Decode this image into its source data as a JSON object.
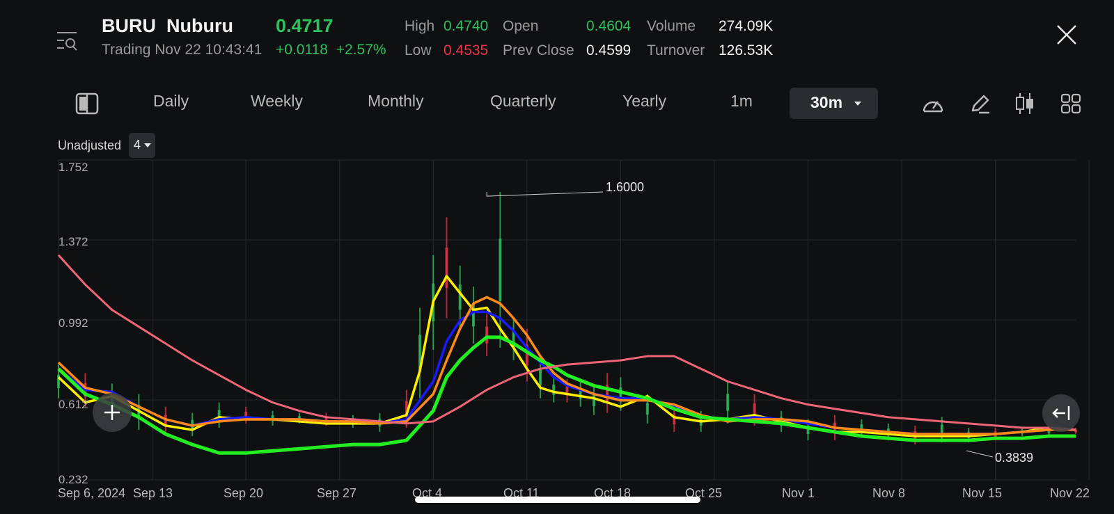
{
  "header": {
    "ticker": "BURU",
    "name": "Nuburu",
    "status": "Trading Nov 22 10:43:41",
    "price": "0.4717",
    "change": "+0.0118",
    "change_pct": "+2.57%",
    "high_label": "High",
    "high_value": "0.4740",
    "low_label": "Low",
    "low_value": "0.4535",
    "open_label": "Open",
    "open_value": "0.4604",
    "prev_close_label": "Prev Close",
    "prev_close_value": "0.4599",
    "volume_label": "Volume",
    "volume_value": "274.09K",
    "turnover_label": "Turnover",
    "turnover_value": "126.53K"
  },
  "tabs": [
    "Daily",
    "Weekly",
    "Monthly",
    "Quarterly",
    "Yearly",
    "1m"
  ],
  "active_tab": "30m",
  "adjust": {
    "label": "Unadjusted",
    "value": "4"
  },
  "icons": [
    "menu-search-icon",
    "close-icon",
    "sidebar-toggle-icon",
    "indicator-gauge-icon",
    "draw-pen-icon",
    "candlestick-icon",
    "grid-icon",
    "collapse-arrow-icon",
    "crosshair-plus-icon"
  ],
  "colors": {
    "up": "#2fbf5f",
    "down": "#e8334a",
    "ma_yellow": "#ffee00",
    "ma_blue": "#1a1aff",
    "ma_orange": "#ff8a1a",
    "ma_green": "#22ee22",
    "ma_pink": "#ee6677"
  },
  "chart_data": {
    "type": "line",
    "title": "",
    "ylim": [
      0.232,
      1.752
    ],
    "yticks": [
      "1.752",
      "1.372",
      "0.992",
      "0.612",
      "0.232"
    ],
    "xticks": [
      "Sep 6, 2024",
      "Sep 13",
      "Sep 20",
      "Sep 27",
      "Oct 4",
      "Oct 11",
      "Oct 18",
      "Oct 25",
      "Nov 1",
      "Nov 8",
      "Nov 15",
      "Nov 22"
    ],
    "annotations": [
      {
        "text": "1.6000",
        "x": "Oct 16",
        "y": 1.6
      },
      {
        "text": "0.3839",
        "x": "Nov 14",
        "y": 0.3839
      }
    ],
    "price_high_low": {
      "x": [
        0,
        2,
        4,
        6,
        8,
        10,
        12,
        14,
        16,
        18,
        20,
        22,
        24,
        26,
        27,
        28,
        29,
        30,
        31,
        32,
        33,
        34,
        35,
        36,
        37,
        38,
        39,
        40,
        41,
        42,
        44,
        46,
        48,
        50,
        52,
        54,
        56,
        58,
        60,
        62,
        64,
        66,
        68,
        70,
        72,
        74,
        76
      ],
      "high": [
        0.78,
        0.74,
        0.69,
        0.64,
        0.58,
        0.55,
        0.6,
        0.58,
        0.56,
        0.55,
        0.55,
        0.54,
        0.55,
        0.66,
        1.05,
        1.3,
        1.48,
        1.25,
        1.15,
        1.02,
        1.6,
        1.0,
        0.95,
        0.82,
        0.72,
        0.71,
        0.7,
        0.68,
        0.74,
        0.72,
        0.64,
        0.58,
        0.56,
        0.7,
        0.64,
        0.56,
        0.52,
        0.54,
        0.52,
        0.5,
        0.49,
        0.53,
        0.48,
        0.48,
        0.48,
        0.49,
        0.48
      ],
      "low": [
        0.62,
        0.58,
        0.52,
        0.47,
        0.45,
        0.44,
        0.48,
        0.5,
        0.49,
        0.5,
        0.49,
        0.48,
        0.46,
        0.48,
        0.62,
        0.85,
        1.0,
        0.95,
        0.88,
        0.82,
        0.86,
        0.8,
        0.7,
        0.62,
        0.6,
        0.6,
        0.58,
        0.54,
        0.55,
        0.56,
        0.5,
        0.46,
        0.46,
        0.5,
        0.49,
        0.46,
        0.42,
        0.42,
        0.44,
        0.42,
        0.4,
        0.41,
        0.41,
        0.42,
        0.44,
        0.44,
        0.45
      ]
    },
    "series": [
      {
        "color": "#ffee00",
        "x": [
          0,
          2,
          4,
          6,
          8,
          10,
          12,
          14,
          16,
          18,
          20,
          22,
          24,
          26,
          27,
          28,
          29,
          30,
          31,
          32,
          33,
          34,
          35,
          36,
          37,
          38,
          40,
          42,
          44,
          46,
          48,
          50,
          52,
          54,
          56,
          58,
          60,
          62,
          64,
          66,
          68,
          70,
          72,
          74,
          76
        ],
        "values": [
          0.72,
          0.6,
          0.63,
          0.56,
          0.49,
          0.47,
          0.53,
          0.52,
          0.52,
          0.51,
          0.5,
          0.5,
          0.5,
          0.54,
          0.75,
          1.08,
          1.2,
          1.12,
          1.04,
          1.05,
          0.95,
          0.86,
          0.76,
          0.67,
          0.65,
          0.64,
          0.62,
          0.58,
          0.63,
          0.53,
          0.51,
          0.52,
          0.54,
          0.51,
          0.48,
          0.46,
          0.46,
          0.45,
          0.44,
          0.44,
          0.44,
          0.45,
          0.46,
          0.48,
          0.47
        ]
      },
      {
        "color": "#1a1aff",
        "x": [
          0,
          2,
          4,
          6,
          8,
          10,
          12,
          14,
          16,
          18,
          20,
          22,
          24,
          26,
          28,
          29,
          30,
          31,
          32,
          33,
          34,
          35,
          36,
          37,
          38,
          40,
          42,
          44,
          46,
          48,
          50,
          52,
          54,
          56,
          58,
          60,
          62,
          64,
          66,
          68,
          70,
          72,
          74,
          76
        ],
        "values": [
          0.76,
          0.66,
          0.65,
          0.58,
          0.52,
          0.49,
          0.52,
          0.53,
          0.52,
          0.52,
          0.51,
          0.51,
          0.5,
          0.52,
          0.7,
          0.89,
          0.99,
          1.03,
          1.03,
          1.0,
          0.94,
          0.86,
          0.79,
          0.72,
          0.68,
          0.64,
          0.62,
          0.62,
          0.58,
          0.53,
          0.52,
          0.53,
          0.52,
          0.5,
          0.48,
          0.47,
          0.46,
          0.45,
          0.45,
          0.45,
          0.45,
          0.46,
          0.47,
          0.47
        ]
      },
      {
        "color": "#ff8a1a",
        "x": [
          0,
          2,
          4,
          6,
          8,
          10,
          12,
          14,
          16,
          18,
          20,
          22,
          24,
          26,
          28,
          29,
          30,
          31,
          32,
          33,
          34,
          35,
          36,
          37,
          38,
          40,
          42,
          44,
          46,
          48,
          50,
          52,
          54,
          56,
          58,
          60,
          62,
          64,
          66,
          68,
          70,
          72,
          74,
          76
        ],
        "values": [
          0.79,
          0.67,
          0.64,
          0.58,
          0.52,
          0.49,
          0.51,
          0.52,
          0.52,
          0.52,
          0.51,
          0.51,
          0.5,
          0.51,
          0.64,
          0.8,
          0.95,
          1.07,
          1.1,
          1.07,
          1.0,
          0.92,
          0.82,
          0.74,
          0.69,
          0.64,
          0.61,
          0.61,
          0.59,
          0.54,
          0.51,
          0.52,
          0.52,
          0.51,
          0.48,
          0.47,
          0.46,
          0.45,
          0.45,
          0.45,
          0.45,
          0.46,
          0.47,
          0.47
        ]
      },
      {
        "color": "#22ee22",
        "x": [
          0,
          2,
          4,
          6,
          8,
          10,
          12,
          14,
          16,
          18,
          20,
          22,
          24,
          26,
          28,
          29,
          30,
          31,
          32,
          33,
          34,
          35,
          36,
          37,
          38,
          40,
          42,
          44,
          46,
          48,
          50,
          52,
          54,
          56,
          58,
          60,
          62,
          64,
          66,
          68,
          70,
          72,
          74,
          76
        ],
        "values": [
          0.76,
          0.64,
          0.59,
          0.53,
          0.45,
          0.4,
          0.36,
          0.36,
          0.37,
          0.38,
          0.39,
          0.4,
          0.4,
          0.42,
          0.56,
          0.72,
          0.8,
          0.86,
          0.91,
          0.91,
          0.88,
          0.84,
          0.8,
          0.77,
          0.73,
          0.68,
          0.65,
          0.62,
          0.57,
          0.53,
          0.52,
          0.51,
          0.5,
          0.48,
          0.46,
          0.44,
          0.43,
          0.42,
          0.42,
          0.42,
          0.43,
          0.43,
          0.44,
          0.44
        ]
      },
      {
        "color": "#ee6677",
        "x": [
          0,
          2,
          4,
          6,
          8,
          10,
          12,
          14,
          16,
          18,
          20,
          22,
          24,
          26,
          28,
          30,
          32,
          34,
          36,
          38,
          40,
          42,
          44,
          46,
          48,
          50,
          52,
          54,
          56,
          58,
          60,
          62,
          64,
          66,
          68,
          70,
          72,
          74,
          76
        ],
        "values": [
          1.3,
          1.16,
          1.04,
          0.96,
          0.88,
          0.8,
          0.73,
          0.66,
          0.6,
          0.56,
          0.53,
          0.52,
          0.51,
          0.5,
          0.51,
          0.58,
          0.66,
          0.72,
          0.76,
          0.78,
          0.79,
          0.8,
          0.82,
          0.82,
          0.76,
          0.7,
          0.66,
          0.62,
          0.59,
          0.57,
          0.55,
          0.53,
          0.52,
          0.51,
          0.5,
          0.49,
          0.48,
          0.48,
          0.47
        ]
      }
    ]
  }
}
